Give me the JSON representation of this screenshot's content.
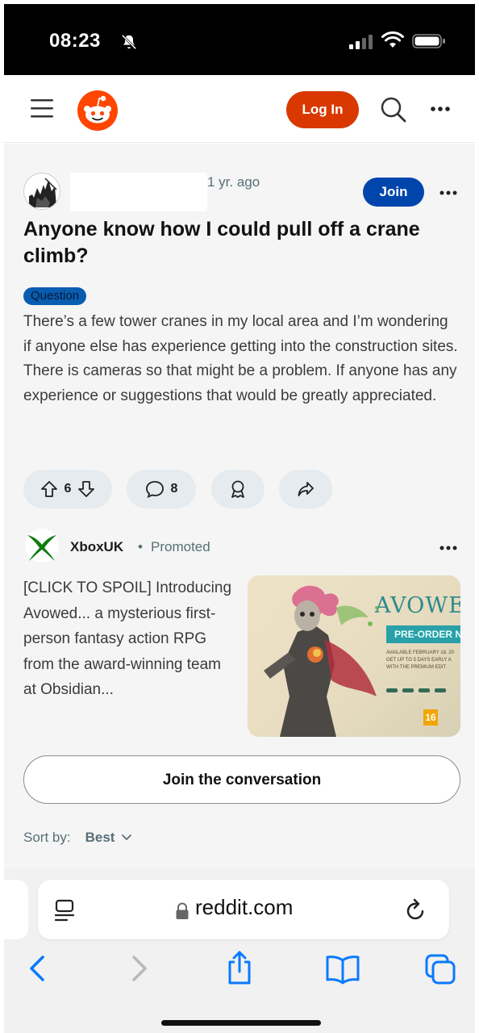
{
  "status_bar": {
    "time": "08:23"
  },
  "header": {
    "login_label": "Log In"
  },
  "post": {
    "time": "1 yr. ago",
    "join_label": "Join",
    "title": "Anyone know how I could pull off a crane climb?",
    "flair": "Question",
    "body": "There’s a few tower cranes in my local area and I’m wondering if anyone else has experience getting into the construction sites. There is cameras so that might be a problem. If anyone has any experience or suggestions that would be greatly appreciated.",
    "votes": "6",
    "comments": "8"
  },
  "promo": {
    "advertiser": "XboxUK",
    "separator": "•",
    "label": "Promoted",
    "text": "[CLICK TO SPOIL] Introducing Avowed... a mysterious first-person fantasy action RPG from the award-winning team at Obsidian...",
    "image": {
      "game_title": "AVOWE",
      "preorder": "PRE-ORDER NOW",
      "fine_print": "AVAILABLE FEBRUARY 18, 20\nGET UP TO 5 DAYS EARLY A\nWITH THE PREMIUM EDIT",
      "rating": "16"
    }
  },
  "join_conversation_label": "Join the conversation",
  "sort": {
    "label": "Sort by:",
    "value": "Best"
  },
  "browser": {
    "url": "reddit.com"
  },
  "colors": {
    "reddit_orange": "#ff4500",
    "login_bg": "#d93900",
    "join_bg": "#0045ac",
    "flair_bg": "#0a5cb0",
    "ios_blue": "#0a7aff",
    "xbox_green": "#107c10"
  },
  "icons": [
    "bell-slash-icon",
    "signal-icon",
    "wifi-icon",
    "battery-icon",
    "menu-icon",
    "reddit-logo",
    "search-icon",
    "more-icon",
    "upvote-icon",
    "downvote-icon",
    "comment-icon",
    "award-icon",
    "share-icon",
    "xbox-logo",
    "reader-icon",
    "lock-icon",
    "reload-icon",
    "back-icon",
    "forward-icon",
    "bookmarks-icon",
    "tabs-icon"
  ]
}
